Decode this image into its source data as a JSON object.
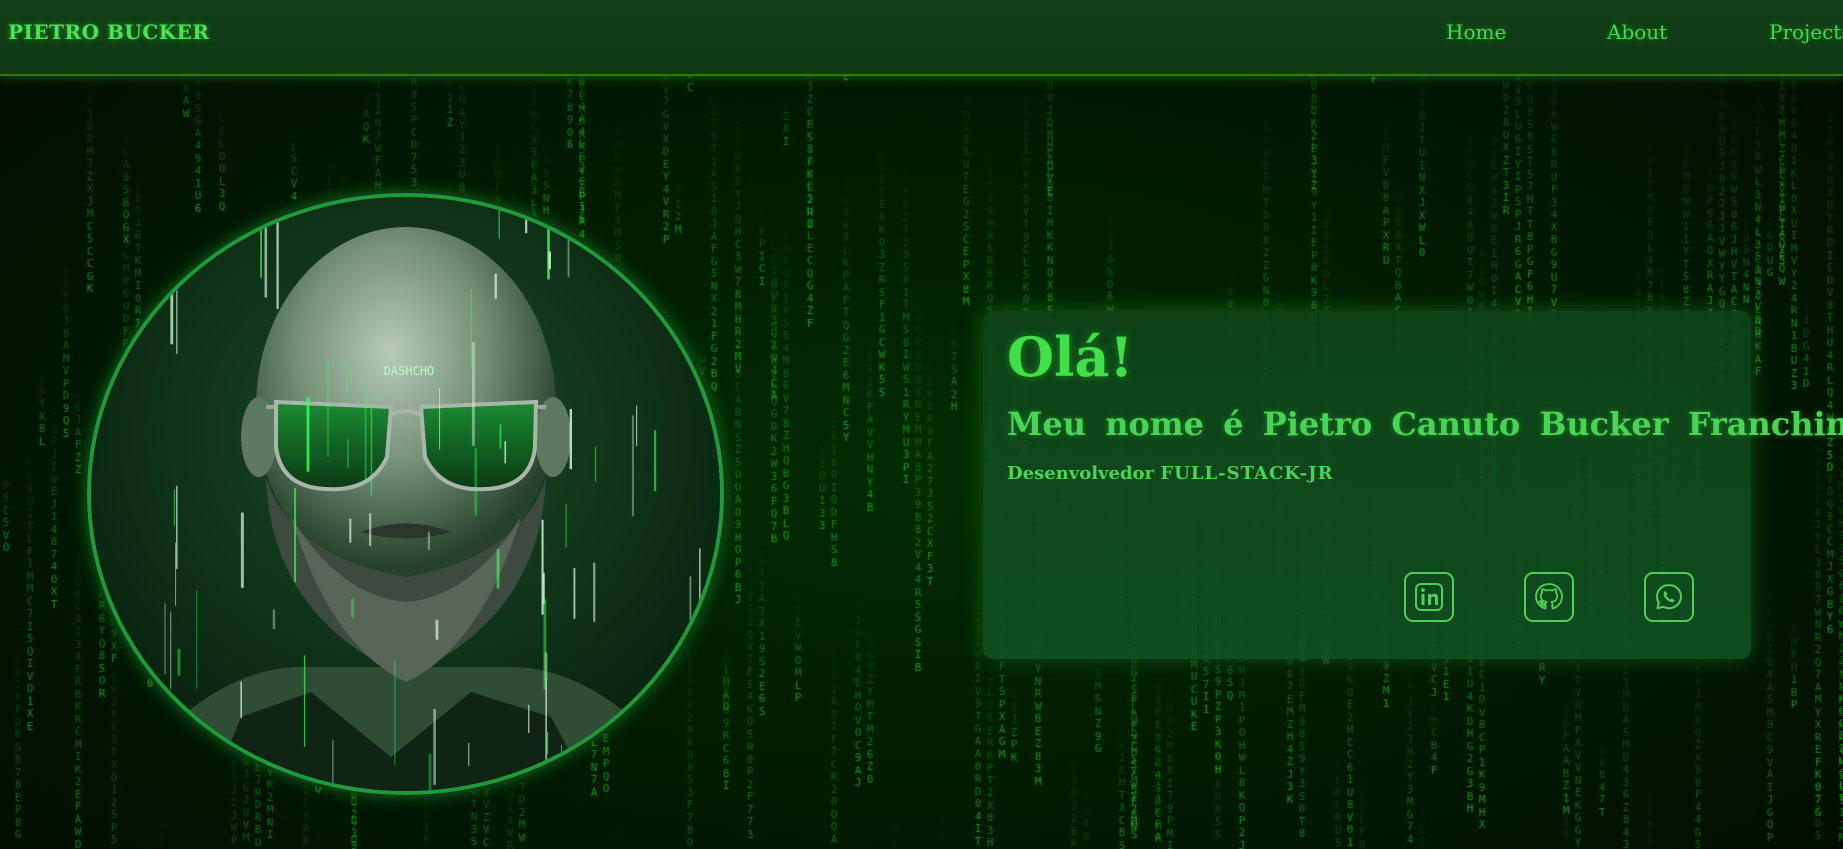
{
  "header": {
    "logo": "PIETRO BUCKER",
    "nav": [
      {
        "label": "Home"
      },
      {
        "label": "About"
      },
      {
        "label": "Projects"
      }
    ]
  },
  "hero": {
    "greeting": "Olá!",
    "name_line": "Meu nome é Pietro Canuto Bucker Franchini",
    "role_prefix": "Desenvolvedor",
    "role_stack": "FULL-STACK-JR",
    "portrait_text": "DASHCHO",
    "social": [
      {
        "icon": "linkedin-icon"
      },
      {
        "icon": "github-icon"
      },
      {
        "icon": "whatsapp-icon"
      }
    ]
  },
  "colors": {
    "accent": "#3fe04a",
    "background": "#011a01",
    "header": "#0f3a14",
    "card": "#10522a"
  }
}
